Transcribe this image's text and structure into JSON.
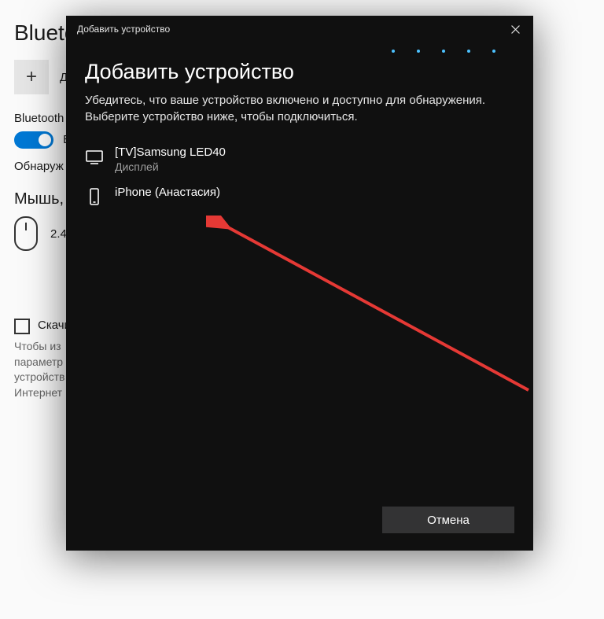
{
  "background": {
    "title": "Blueto",
    "add_label": "До",
    "bluetooth_label": "Bluetooth",
    "toggle_on_label": "В",
    "discover_label": "Обнаруж",
    "mouse_section_title": "Мышь,",
    "mouse_device": "2.4",
    "download_cb_label": "Скачи",
    "download_desc_1": "Чтобы из",
    "download_desc_2": "параметр",
    "download_desc_3": "устройств",
    "download_desc_4": "Интернет"
  },
  "dialog": {
    "titlebar": "Добавить устройство",
    "heading": "Добавить устройство",
    "subtext": "Убедитесь, что ваше устройство включено и доступно для обнаружения. Выберите устройство ниже, чтобы подключиться.",
    "devices": [
      {
        "name": "[TV]Samsung LED40",
        "type": "Дисплей",
        "icon": "display"
      },
      {
        "name": "iPhone (Анастасия)",
        "type": "",
        "icon": "phone"
      }
    ],
    "cancel": "Отмена"
  },
  "colors": {
    "accent": "#0078d4",
    "arrow": "#e53935"
  }
}
